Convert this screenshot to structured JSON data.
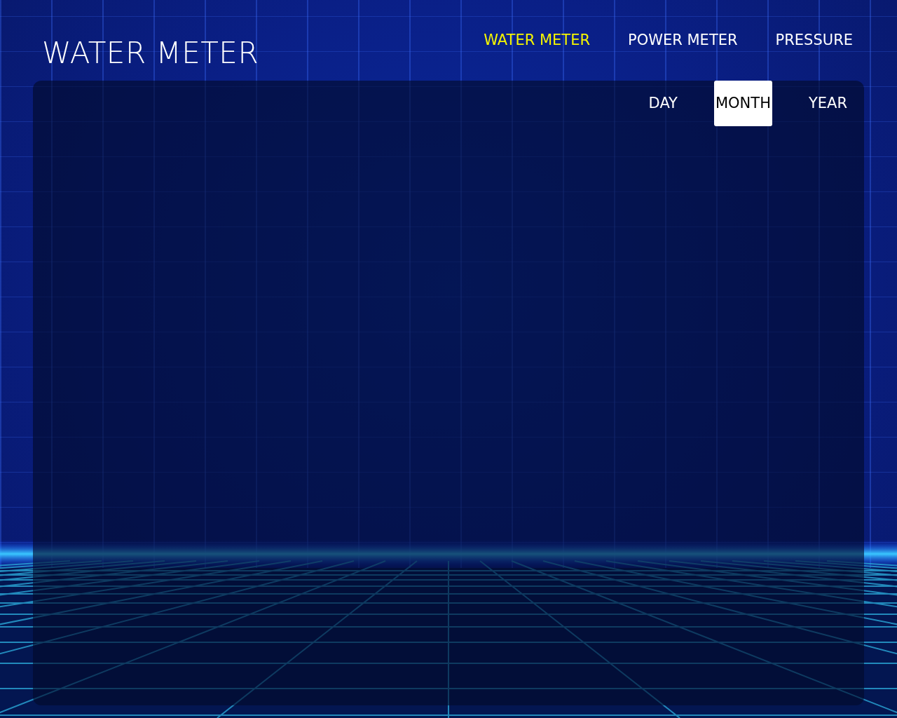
{
  "title": "WATER METER",
  "nav": [
    {
      "label": "WATER METER",
      "selected": true
    },
    {
      "label": "POWER METER",
      "selected": false
    },
    {
      "label": "PRESSURE",
      "selected": false
    }
  ],
  "period_tabs": [
    {
      "label": "DAY",
      "selected": false
    },
    {
      "label": "MONTH",
      "selected": true
    },
    {
      "label": "YEAR",
      "selected": false
    }
  ]
}
